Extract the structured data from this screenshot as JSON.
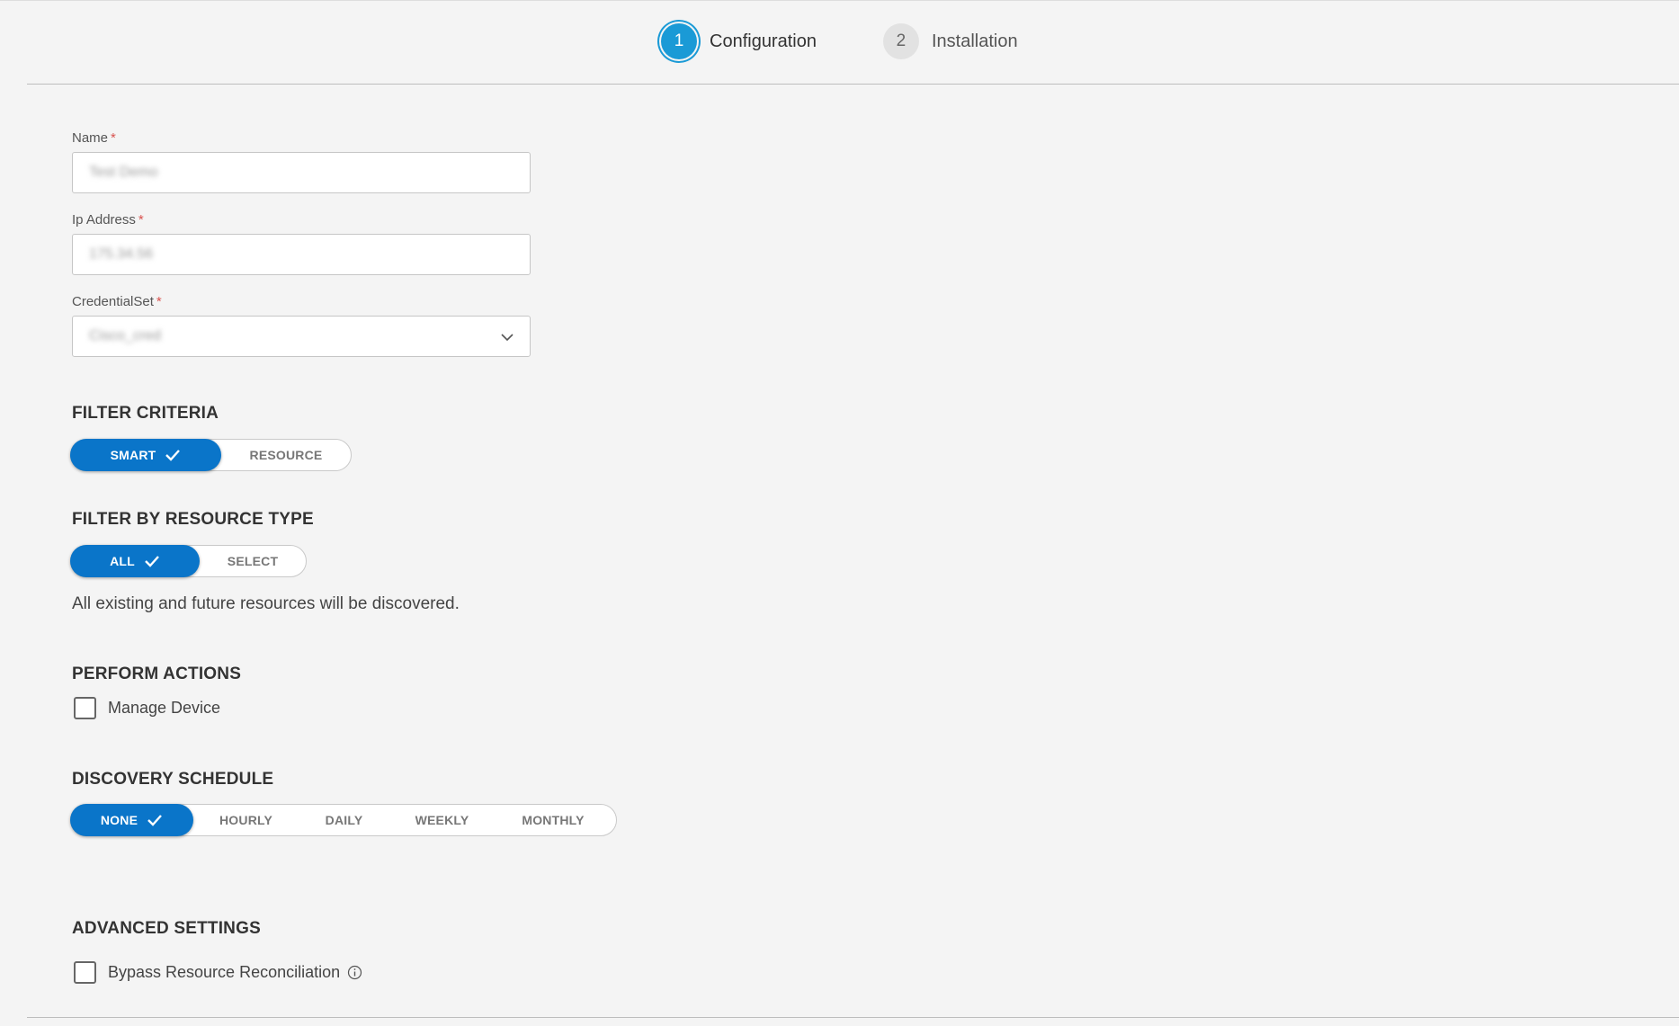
{
  "stepper": {
    "steps": [
      {
        "number": "1",
        "label": "Configuration",
        "state": "active"
      },
      {
        "number": "2",
        "label": "Installation",
        "state": "inactive"
      }
    ]
  },
  "form": {
    "name": {
      "label": "Name",
      "required_mark": "*",
      "value": "Test Demo"
    },
    "ip_address": {
      "label": "Ip Address",
      "required_mark": "*",
      "value": "175.34.56"
    },
    "credential_set": {
      "label": "CredentialSet",
      "required_mark": "*",
      "value": "Cisco_cred"
    }
  },
  "filter_criteria": {
    "title": "FILTER CRITERIA",
    "options": [
      "SMART",
      "RESOURCE"
    ],
    "selected": "SMART"
  },
  "filter_by_resource_type": {
    "title": "FILTER BY RESOURCE TYPE",
    "options": [
      "ALL",
      "SELECT"
    ],
    "selected": "ALL",
    "description": "All existing and future resources will be discovered."
  },
  "perform_actions": {
    "title": "PERFORM ACTIONS",
    "manage_device": {
      "label": "Manage Device",
      "checked": false
    }
  },
  "discovery_schedule": {
    "title": "DISCOVERY SCHEDULE",
    "options": [
      "NONE",
      "HOURLY",
      "DAILY",
      "WEEKLY",
      "MONTHLY"
    ],
    "selected": "NONE"
  },
  "advanced_settings": {
    "title": "ADVANCED SETTINGS",
    "bypass": {
      "label": "Bypass Resource Reconciliation",
      "checked": false
    }
  },
  "colors": {
    "accent": "#0a75c9",
    "step_active": "#1a9ad6",
    "required": "#d9534f",
    "background": "#f4f4f4"
  },
  "icons": {
    "check": "check-icon",
    "chevron": "chevron-down-icon",
    "info": "info-icon"
  }
}
